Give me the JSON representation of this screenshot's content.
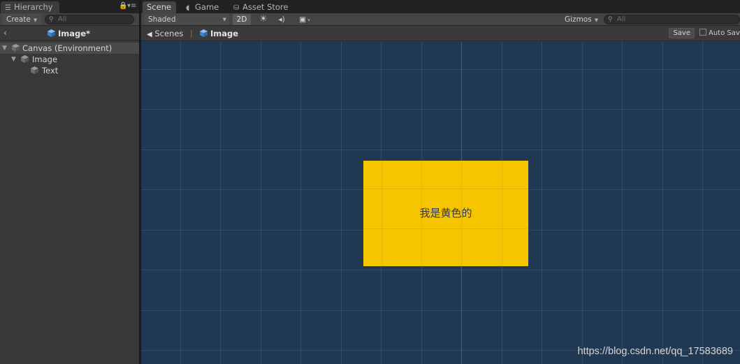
{
  "hierarchy": {
    "tab_label": "Hierarchy",
    "create_label": "Create",
    "search_placeholder": "All",
    "breadcrumb_title": "Image*",
    "items": [
      {
        "label": "Canvas (Environment)"
      },
      {
        "label": "Image"
      },
      {
        "label": "Text"
      }
    ]
  },
  "tabs": {
    "scene": "Scene",
    "game": "Game",
    "asset_store": "Asset Store"
  },
  "scene_toolbar": {
    "shading_mode": "Shaded",
    "mode_2d": "2D",
    "gizmos_label": "Gizmos",
    "search_placeholder": "All"
  },
  "scene_breadcrumb": {
    "scenes_label": "Scenes",
    "current": "Image",
    "save_label": "Save",
    "auto_save_label": "Auto Save"
  },
  "viewport": {
    "image_text": "我是黄色的",
    "image_color": "#f5c500",
    "background_color": "#213852"
  },
  "watermark": "https://blog.csdn.net/qq_17583689",
  "icons": {
    "hierarchy_tab": "list-icon",
    "lock": "lock-icon",
    "menu": "menu-icon",
    "search": "search-icon",
    "game_tab": "pacman-icon",
    "asset_store_tab": "shopping-bag-icon",
    "sun": "sun-icon",
    "audio": "speaker-icon",
    "effects": "image-icon",
    "unity": "unity-icon",
    "gameobject": "cube-icon"
  }
}
